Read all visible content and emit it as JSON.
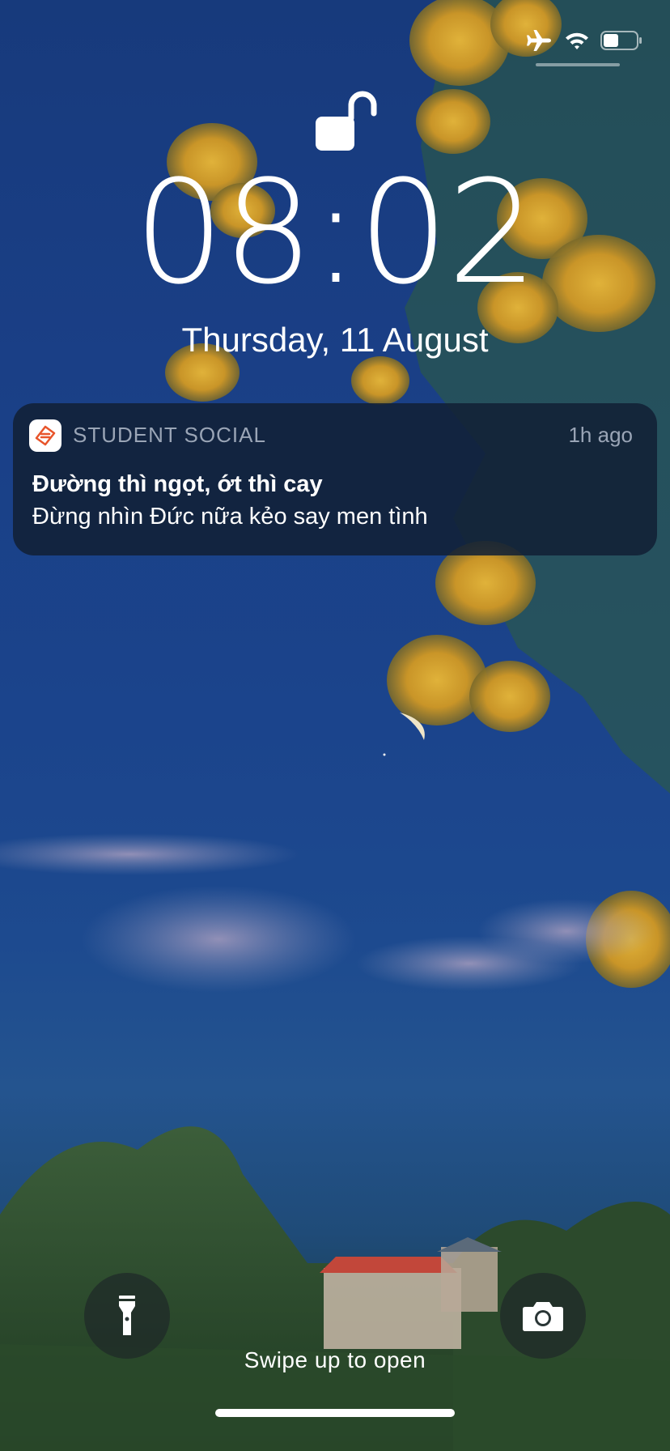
{
  "status_bar": {
    "airplane_icon": "airplane-icon",
    "wifi_icon": "wifi-icon",
    "battery_icon": "battery-icon",
    "battery_level": 0.45
  },
  "lock": {
    "icon": "unlocked-padlock-icon",
    "time": "08:02",
    "date": "Thursday, 11 August"
  },
  "notification": {
    "app_icon": "student-social-app-icon",
    "app_name": "STUDENT SOCIAL",
    "time": "1h ago",
    "title": "Đường thì ngọt, ớt thì cay",
    "body": "Đừng nhìn Đức nữa kẻo say men tình",
    "brand_color": "#e8552b"
  },
  "bottom": {
    "flashlight_icon": "flashlight-icon",
    "camera_icon": "camera-icon",
    "swipe_hint": "Swipe up to open"
  }
}
